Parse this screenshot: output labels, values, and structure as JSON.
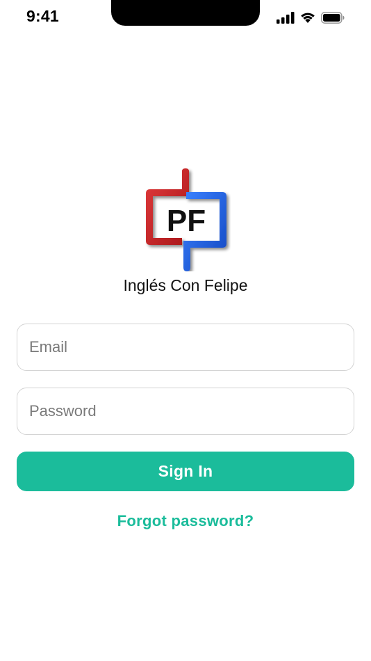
{
  "status_bar": {
    "time": "9:41",
    "icons": [
      "signal-icon",
      "wifi-icon",
      "battery-icon"
    ]
  },
  "logo": {
    "text": "PF",
    "colors": {
      "red": "#c41e20",
      "blue": "#1d63e6"
    }
  },
  "app_name": "Inglés Con Felipe",
  "form": {
    "email_placeholder": "Email",
    "password_placeholder": "Password",
    "sign_in_label": "Sign In",
    "forgot_label": "Forgot password?"
  },
  "colors": {
    "accent": "#1bbc9b"
  }
}
